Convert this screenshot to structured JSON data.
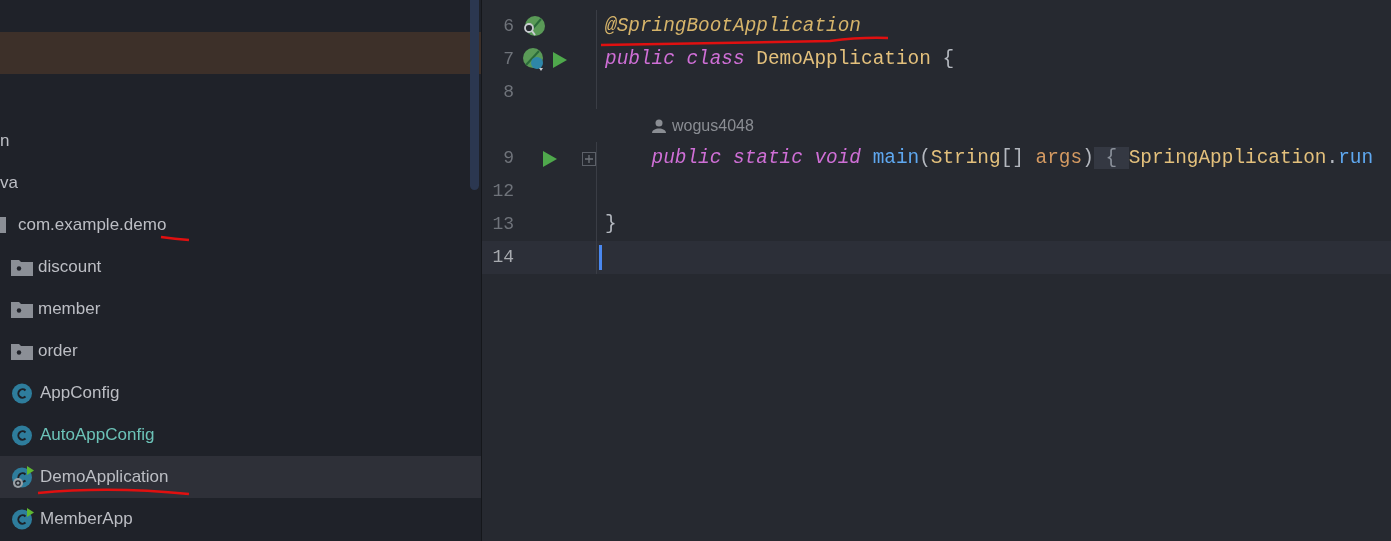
{
  "project_tree": {
    "items": [
      {
        "label": "n",
        "color": "#bcbec4",
        "selected": false,
        "children": [
          {
            "label": "va",
            "color": "#bcbec4",
            "selected": false,
            "children": [
              {
                "label": "com.example.demo",
                "kind": "package",
                "color": "#bcbec4",
                "selected": false,
                "children": [
                  {
                    "label": "discount",
                    "kind": "folder",
                    "color": "#bcbec4",
                    "selected": false
                  },
                  {
                    "label": "member",
                    "kind": "folder",
                    "color": "#bcbec4",
                    "selected": false
                  },
                  {
                    "label": "order",
                    "kind": "folder",
                    "color": "#bcbec4",
                    "selected": false
                  },
                  {
                    "label": "AppConfig",
                    "kind": "class",
                    "color": "#bcbec4",
                    "selected": false
                  },
                  {
                    "label": "AutoAppConfig",
                    "kind": "class",
                    "color": "#6cc3b8",
                    "selected": false
                  },
                  {
                    "label": "DemoApplication",
                    "kind": "spring_app",
                    "color": "#bcbec4",
                    "selected": true
                  },
                  {
                    "label": "MemberApp",
                    "kind": "runnable_class",
                    "color": "#bcbec4",
                    "selected": false
                  }
                ]
              }
            ]
          }
        ]
      }
    ]
  },
  "editor": {
    "lines": [
      {
        "kind": "code",
        "number": "6",
        "current": false,
        "folded": false,
        "gutter_icons": [
          {
            "kind": "bean_search"
          }
        ],
        "tokens": [
          {
            "kind": "annotation",
            "text": "@SpringBootApplication"
          }
        ]
      },
      {
        "kind": "code",
        "number": "7",
        "current": false,
        "folded": false,
        "gutter_icons": [
          {
            "kind": "bean"
          },
          {
            "kind": "run"
          }
        ],
        "tokens": [
          {
            "kind": "keyword",
            "text": "public class "
          },
          {
            "kind": "class",
            "text": "DemoApplication "
          },
          {
            "kind": "plain",
            "text": "{"
          }
        ]
      },
      {
        "kind": "code",
        "number": "8",
        "current": false,
        "folded": false
      },
      {
        "kind": "author_hint",
        "author": "wogus4048"
      },
      {
        "kind": "code",
        "number": "9",
        "current": false,
        "folded": true,
        "gutter_icons": [
          {
            "kind": "run"
          }
        ],
        "tokens": [
          {
            "kind": "keyword",
            "text": "    public static void "
          },
          {
            "kind": "method",
            "text": "main"
          },
          {
            "kind": "plain",
            "text": "("
          },
          {
            "kind": "class",
            "text": "String"
          },
          {
            "kind": "plain",
            "text": "[] "
          },
          {
            "kind": "param",
            "text": "args"
          },
          {
            "kind": "plain",
            "text": ")"
          },
          {
            "kind": "matched_brace",
            "text": "{"
          },
          {
            "kind": "class",
            "text": "SpringApplication"
          },
          {
            "kind": "plain",
            "text": "."
          },
          {
            "kind": "method",
            "text": "run"
          }
        ]
      },
      {
        "kind": "code",
        "number": "12",
        "current": false,
        "folded": false
      },
      {
        "kind": "code",
        "number": "13",
        "current": false,
        "folded": false,
        "tokens": [
          {
            "kind": "plain",
            "text": "}"
          }
        ]
      },
      {
        "kind": "code",
        "number": "14",
        "current": true,
        "folded": false
      }
    ]
  }
}
